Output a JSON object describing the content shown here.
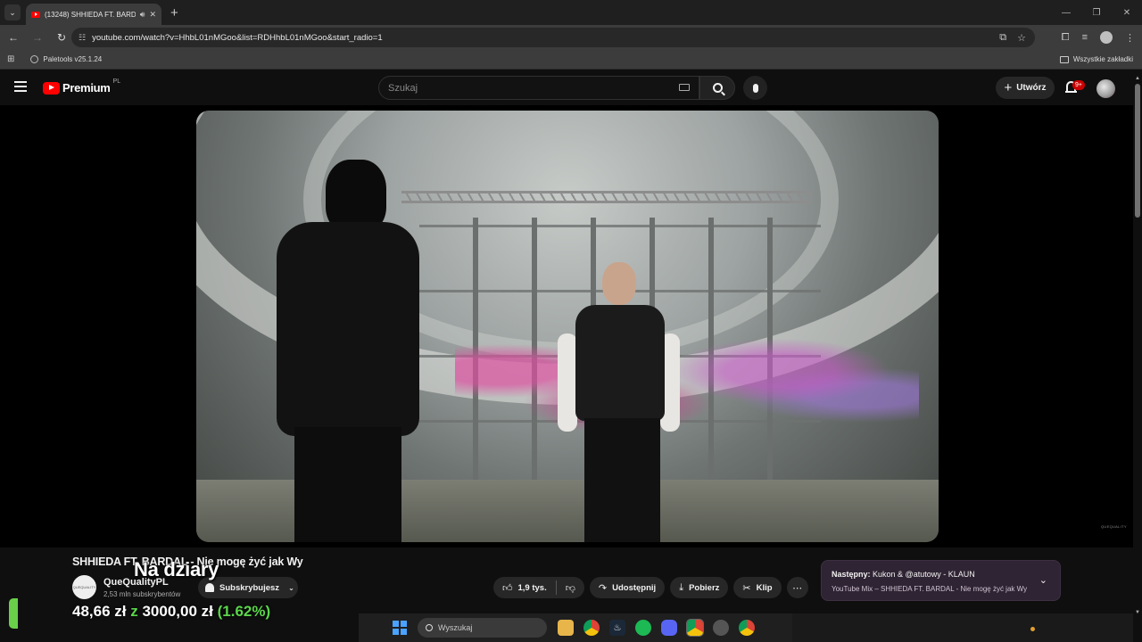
{
  "browser": {
    "tab_title": "(13248) SHHIEDA FT. BARD",
    "url": "youtube.com/watch?v=HhbL01nMGoo&list=RDHhbL01nMGoo&start_radio=1",
    "bookmark_label": "Paletools v25.1.24",
    "all_bookmarks_label": "Wszystkie zakładki"
  },
  "youtube": {
    "logo_text": "Premium",
    "logo_country": "PL",
    "search_placeholder": "Szukaj",
    "create_label": "Utwórz",
    "notifications_badge": "9+"
  },
  "video": {
    "watermark": "QUEQUALITY",
    "title": "SHHIEDA FT. BARDAL - Nie mogę żyć jak Wy",
    "channel_name": "QueQualityPL",
    "channel_subs": "2,53 mln subskrybentów",
    "channel_avatar_text": "QUEQUALITY",
    "subscribe_label": "Subskrybujesz",
    "likes": "1,9 tys.",
    "share_label": "Udostępnij",
    "download_label": "Pobierz",
    "clip_label": "Klip"
  },
  "next_up": {
    "prefix": "Następny:",
    "title": "Kukon & @atutowy - KLAUN",
    "subtitle": "YouTube Mix – SHHIEDA FT. BARDAL - Nie mogę żyć jak Wy"
  },
  "overlay": {
    "caption": "Na dziary",
    "donation_amount": "48,66 zł",
    "donation_sep": "z",
    "donation_goal": "3000,00 zł",
    "donation_percent": "(1.62%)",
    "progress_fraction": 0.0162,
    "accent_color": "#5bd64b"
  },
  "taskbar": {
    "search_placeholder": "Wyszukaj"
  },
  "icons": [
    "tab-list-icon",
    "youtube-favicon",
    "audio-icon",
    "close-icon",
    "new-tab-icon",
    "back-icon",
    "forward-icon",
    "reload-icon",
    "site-settings-icon",
    "install-icon",
    "star-icon",
    "extensions-icon",
    "media-icon",
    "profile-icon",
    "kebab-icon",
    "apps-icon",
    "folder-icon",
    "menu-icon",
    "keyboard-icon",
    "search-icon",
    "mic-icon",
    "plus-icon",
    "bell-icon",
    "avatar",
    "like-icon",
    "dislike-icon",
    "share-icon",
    "download-icon",
    "scissors-icon",
    "more-icon",
    "chevron-down-icon",
    "windows-start-icon"
  ]
}
